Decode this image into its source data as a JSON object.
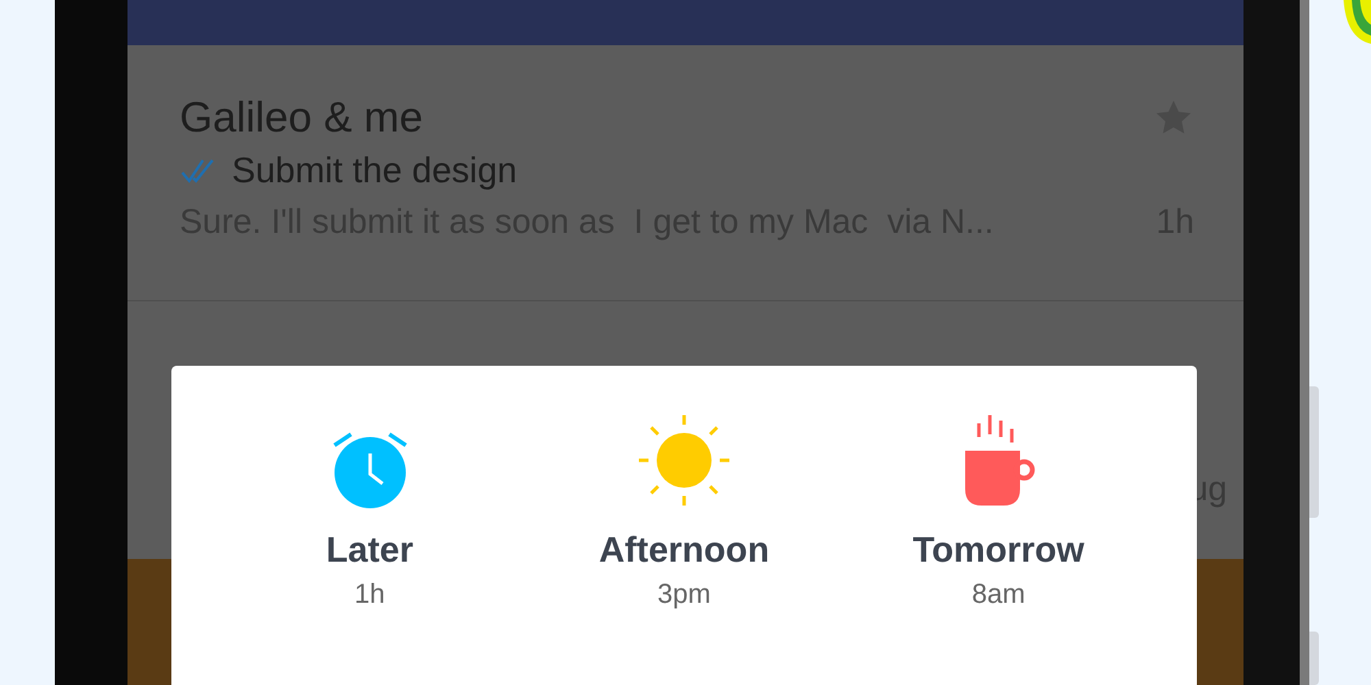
{
  "conversations": [
    {
      "participants": "Galileo & me",
      "read": true,
      "subject": "Submit the design",
      "preview": "Sure. I'll submit it as soon as  I get to my Mac  via N...",
      "time": "1h",
      "starred": false
    },
    {
      "time": "ug"
    }
  ],
  "snooze_options": [
    {
      "kind": "alarm",
      "label": "Later",
      "time": "1h"
    },
    {
      "kind": "sun",
      "label": "Afternoon",
      "time": "3pm"
    },
    {
      "kind": "cup",
      "label": "Tomorrow",
      "time": "8am"
    }
  ]
}
